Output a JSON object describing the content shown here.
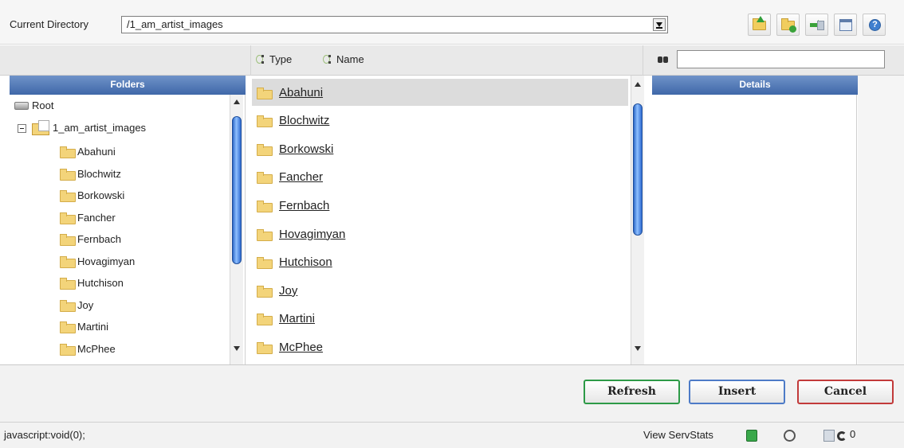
{
  "toolbar": {
    "directory_label": "Current Directory",
    "directory_value": "/1_am_artist_images",
    "icons": [
      "folder-up-icon",
      "new-folder-icon",
      "move-icon",
      "window-icon",
      "help-icon"
    ]
  },
  "header": {
    "sort_type_label": "Type",
    "sort_name_label": "Name",
    "search_value": ""
  },
  "folders_panel": {
    "title": "Folders",
    "root_label": "Root",
    "current_label": "1_am_artist_images",
    "children": [
      "Abahuni",
      "Blochwitz",
      "Borkowski",
      "Fancher",
      "Fernbach",
      "Hovagimyan",
      "Hutchison",
      "Joy",
      "Martini",
      "McPhee"
    ]
  },
  "file_list": {
    "items": [
      "Abahuni",
      "Blochwitz",
      "Borkowski",
      "Fancher",
      "Fernbach",
      "Hovagimyan",
      "Hutchison",
      "Joy",
      "Martini",
      "McPhee"
    ],
    "selected": "Abahuni"
  },
  "details_panel": {
    "title": "Details"
  },
  "actions": {
    "refresh": "Refresh",
    "insert": "Insert",
    "cancel": "Cancel"
  },
  "status_bar": {
    "status": "javascript:void(0);",
    "stats_label": "View ServStats",
    "counter": "0"
  }
}
